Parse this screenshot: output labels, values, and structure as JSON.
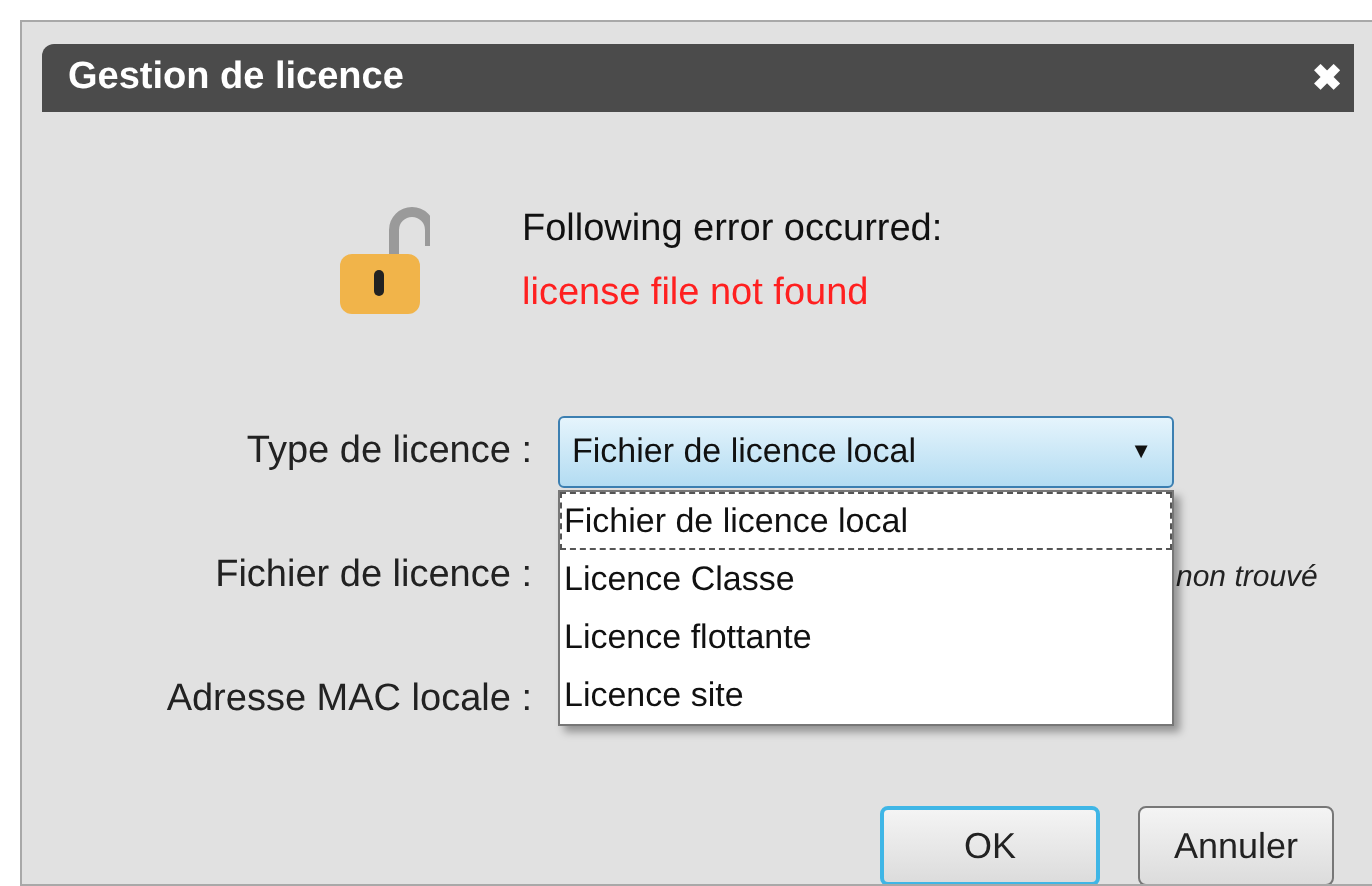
{
  "window": {
    "title": "Gestion de licence",
    "close": "✖"
  },
  "error": {
    "heading": "Following error occurred:",
    "message": "license file not found"
  },
  "type_field": {
    "label": "Type de licence :",
    "value": "Fichier de licence local",
    "caret": "▼",
    "expanded": true,
    "options": [
      {
        "label": "Fichier de licence local",
        "selected": true
      },
      {
        "label": "Licence Classe",
        "selected": false
      },
      {
        "label": "Licence flottante",
        "selected": false
      },
      {
        "label": "Licence site",
        "selected": false
      }
    ]
  },
  "file_field": {
    "label": "Fichier de licence :",
    "status": "non trouvé"
  },
  "mac_field": {
    "label": "Adresse MAC locale :"
  },
  "buttons": [
    {
      "label": "OK",
      "default": true
    },
    {
      "label": "Annuler",
      "default": false
    }
  ]
}
